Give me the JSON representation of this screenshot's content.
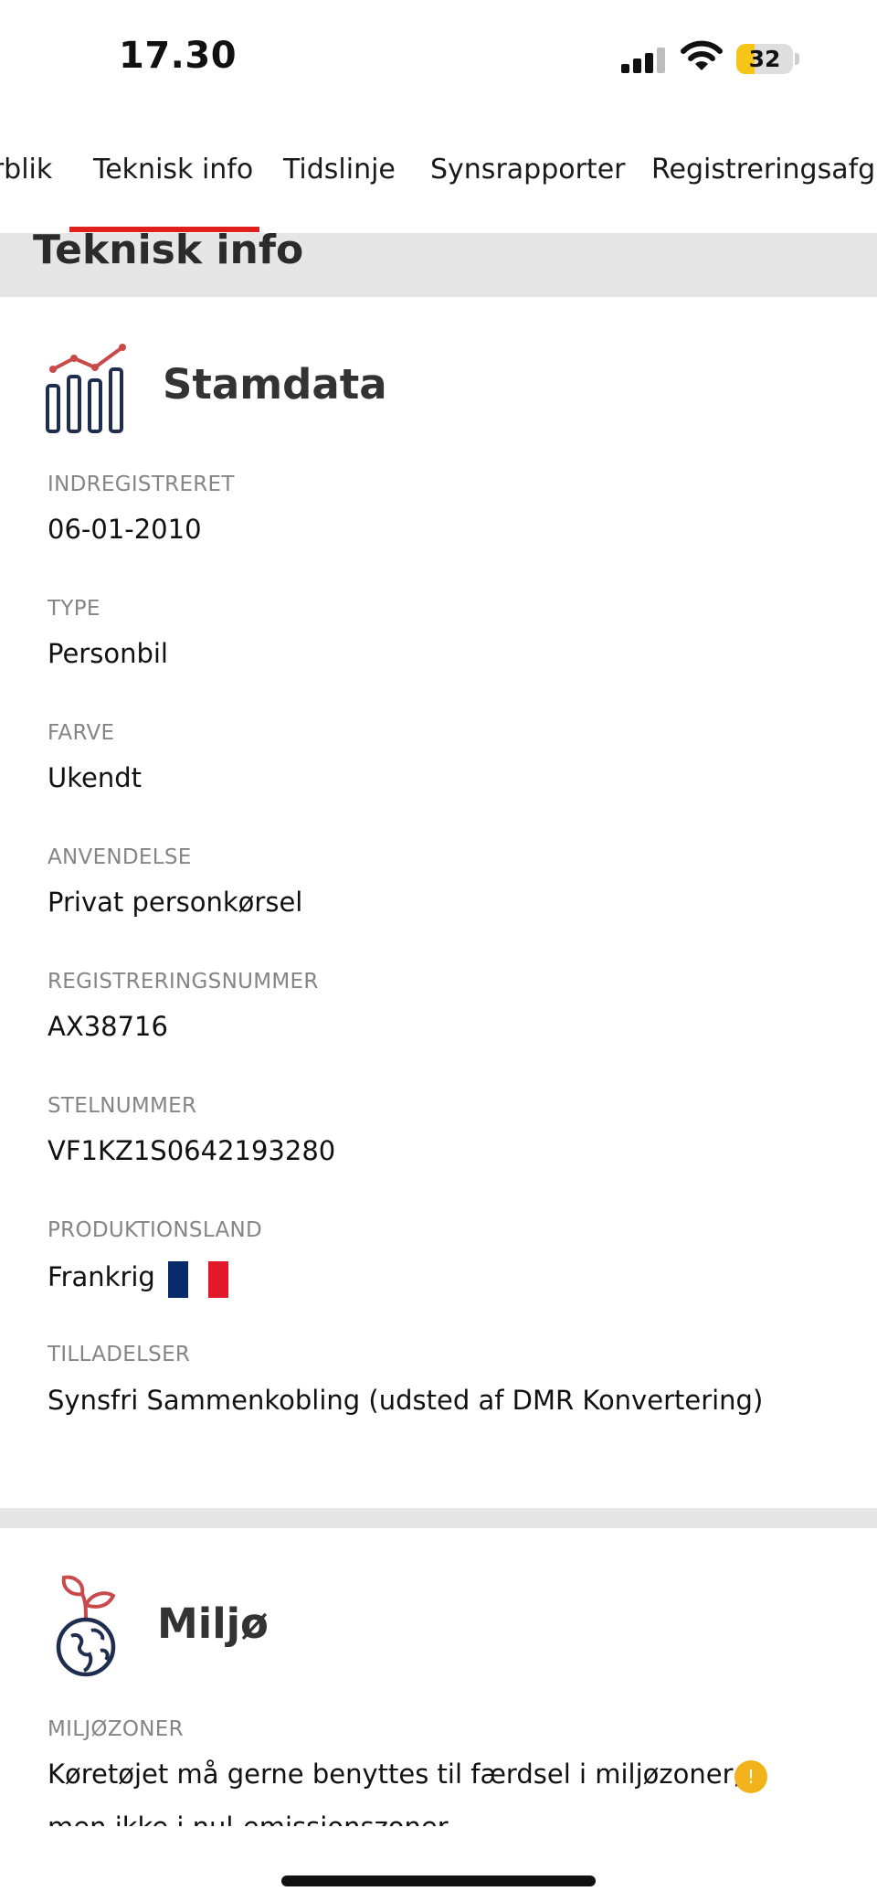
{
  "status_bar": {
    "time": "17.30",
    "battery": "32"
  },
  "tabs": [
    {
      "label": "Overblik"
    },
    {
      "label": "Teknisk info",
      "active": true
    },
    {
      "label": "Tidslinje"
    },
    {
      "label": "Synsrapporter"
    },
    {
      "label": "Registreringsafgift"
    }
  ],
  "section_title": "Teknisk info",
  "stamdata": {
    "title": "Stamdata",
    "fields": [
      {
        "label": "INDREGISTRERET",
        "value": "06-01-2010"
      },
      {
        "label": "TYPE",
        "value": "Personbil"
      },
      {
        "label": "FARVE",
        "value": "Ukendt"
      },
      {
        "label": "ANVENDELSE",
        "value": "Privat personkørsel"
      },
      {
        "label": "REGISTRERINGSNUMMER",
        "value": "AX38716"
      },
      {
        "label": "STELNUMMER",
        "value": "VF1KZ1S0642193280"
      },
      {
        "label": "PRODUKTIONSLAND",
        "value": "Frankrig"
      },
      {
        "label": "TILLADELSER",
        "value": "Synsfri Sammenkobling (udsted af DMR Konvertering)"
      }
    ]
  },
  "miljo": {
    "title": "Miljø",
    "label": "MILJØZONER",
    "line1": "Køretøjet må gerne benyttes til færdsel i miljøzoner,",
    "line2": "men ikke i nul-emissionszoner"
  },
  "colors": {
    "accent": "#e0201f",
    "icon_navy": "#1f2d4f",
    "icon_red": "#c94a4a",
    "warning": "#f2b21b",
    "flag_blue": "#0a2a6b",
    "flag_red": "#e1192a"
  },
  "icons": {
    "stamdata": "bar-chart-trend-icon",
    "miljo": "globe-plant-icon",
    "warning": "info-warning-icon"
  }
}
